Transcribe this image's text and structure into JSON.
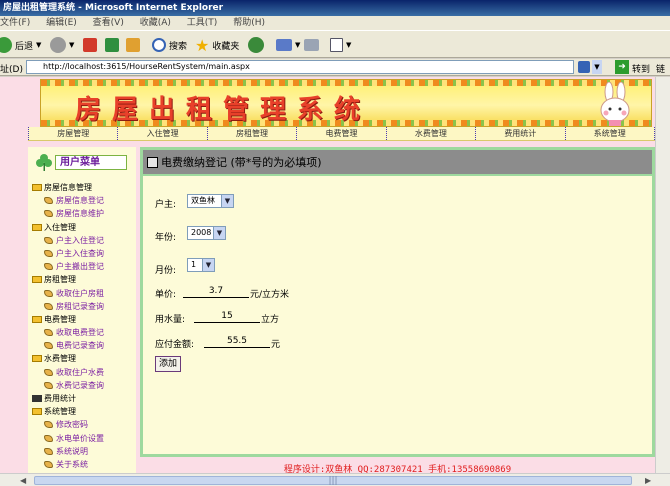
{
  "window": {
    "title": "房屋出租管理系统 - Microsoft Internet Explorer"
  },
  "menubar": [
    "文件(F)",
    "编辑(E)",
    "查看(V)",
    "收藏(A)",
    "工具(T)",
    "帮助(H)"
  ],
  "toolbar": {
    "back": "后退",
    "search": "搜索",
    "favorites": "收藏夹"
  },
  "address": {
    "label": "址(D)",
    "url": "http://localhost:3615/HourseRentSystem/main.aspx",
    "go": "转到",
    "links": "链接"
  },
  "banner": {
    "title_a": "房屋出租",
    "title_b": "管理系统"
  },
  "nav": [
    "房屋管理",
    "入住管理",
    "房租管理",
    "电费管理",
    "水费管理",
    "费用统计",
    "系统管理"
  ],
  "sidebar": {
    "header": "用户菜单",
    "tree": [
      {
        "type": "group",
        "label": "房屋信息管理"
      },
      {
        "type": "item",
        "label": "房屋信息登记"
      },
      {
        "type": "item",
        "label": "房屋信息维护"
      },
      {
        "type": "group",
        "label": "入住管理"
      },
      {
        "type": "item",
        "label": "户主入住登记"
      },
      {
        "type": "item",
        "label": "户主入住查询"
      },
      {
        "type": "item",
        "label": "户主搬出登记"
      },
      {
        "type": "group",
        "label": "房租管理"
      },
      {
        "type": "item",
        "label": "收取住户房租"
      },
      {
        "type": "item",
        "label": "房租记录查询"
      },
      {
        "type": "group",
        "label": "电费管理"
      },
      {
        "type": "item",
        "label": "收取电费登记"
      },
      {
        "type": "item",
        "label": "电费记录查询"
      },
      {
        "type": "group",
        "label": "水费管理"
      },
      {
        "type": "item",
        "label": "收取住户水费"
      },
      {
        "type": "item",
        "label": "水费记录查询"
      },
      {
        "type": "group2",
        "label": "费用统计"
      },
      {
        "type": "group",
        "label": "系统管理"
      },
      {
        "type": "item",
        "label": "修改密码"
      },
      {
        "type": "item",
        "label": "水电单价设置"
      },
      {
        "type": "item",
        "label": "系统说明"
      },
      {
        "type": "item",
        "label": "关于系统"
      }
    ]
  },
  "form": {
    "title": "电费缴纳登记 (带*号的为必填项)",
    "owner_label": "户主:",
    "owner_value": "双鱼林",
    "year_label": "年份:",
    "year_value": "2008",
    "month_label": "月份:",
    "month_value": "1",
    "price_label": "单价:",
    "price_value": "3.7",
    "price_unit": "元/立方米",
    "usage_label": "用水量:",
    "usage_value": "15",
    "usage_unit": "立方",
    "amount_label": "应付金额:",
    "amount_value": "55.5",
    "amount_unit": "元",
    "add_button": "添加"
  },
  "footer": "程序设计:双鱼林 QQ:287307421 手机:13558690869"
}
